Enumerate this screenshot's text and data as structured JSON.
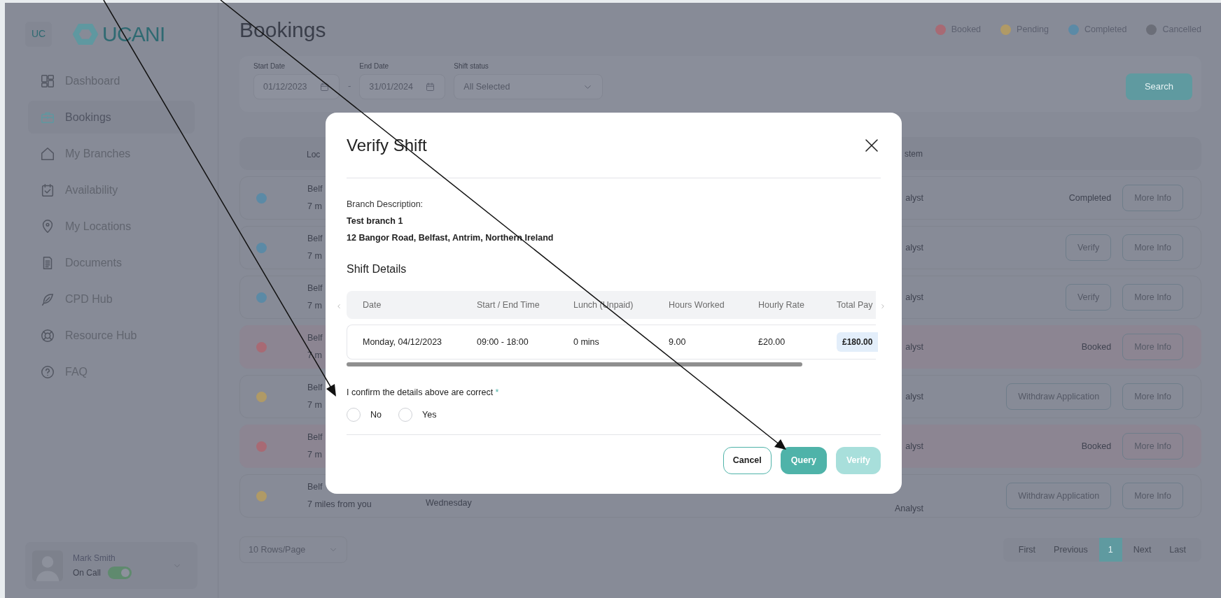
{
  "sidebar": {
    "badge": "UC",
    "logo": "UCANI",
    "items": [
      {
        "label": "Dashboard",
        "selected": false
      },
      {
        "label": "Bookings",
        "selected": true
      },
      {
        "label": "My Branches",
        "selected": false
      },
      {
        "label": "Availability",
        "selected": false
      },
      {
        "label": "My Locations",
        "selected": false
      },
      {
        "label": "Documents",
        "selected": false
      },
      {
        "label": "CPD Hub",
        "selected": false
      },
      {
        "label": "Resource Hub",
        "selected": false
      },
      {
        "label": "FAQ",
        "selected": false
      }
    ],
    "user": {
      "name": "Mark Smith",
      "status": "On Call",
      "on": true
    }
  },
  "header": {
    "title": "Bookings",
    "legend": [
      {
        "label": "Booked",
        "color": "#a86a74"
      },
      {
        "label": "Pending",
        "color": "#b09a66"
      },
      {
        "label": "Completed",
        "color": "#5b8aa6"
      },
      {
        "label": "Cancelled",
        "color": "#6b6e78"
      }
    ]
  },
  "filters": {
    "start_date": {
      "label": "Start Date",
      "value": "01/12/2023"
    },
    "separator": "-",
    "end_date": {
      "label": "End Date",
      "value": "31/01/2024"
    },
    "shift_status": {
      "label": "Shift status",
      "value": "All Selected"
    },
    "search": "Search"
  },
  "table": {
    "columns": [
      "Loc",
      "stem"
    ],
    "rows": [
      {
        "color": "#5b8aa6",
        "highlighted": false,
        "location": "Belf",
        "distance": "7 m",
        "role": "alyst",
        "status": "Completed",
        "actions": [
          "More Info"
        ]
      },
      {
        "color": "#5b8aa6",
        "highlighted": false,
        "location": "Belf",
        "distance": "7 m",
        "role": "alyst",
        "actions": [
          "Verify",
          "More Info"
        ]
      },
      {
        "color": "#5b8aa6",
        "highlighted": false,
        "location": "Belf",
        "distance": "7 m",
        "role": "alyst",
        "actions": [
          "Verify",
          "More Info"
        ]
      },
      {
        "color": "#a86a74",
        "highlighted": true,
        "location": "Belf",
        "distance": "7 m",
        "role": "alyst",
        "status": "Booked",
        "actions": [
          "More Info"
        ]
      },
      {
        "color": "#b09a66",
        "highlighted": false,
        "location": "Belf",
        "distance": "7 m",
        "role": "alyst",
        "actions": [
          "Withdraw Application",
          "More Info"
        ]
      },
      {
        "color": "#a86a74",
        "highlighted": true,
        "location": "Belf",
        "distance": "7 m",
        "role": "alyst",
        "status": "Booked",
        "actions": [
          "More Info"
        ]
      },
      {
        "color": "#b09a66",
        "highlighted": false,
        "location": "Belf",
        "distance": "7 miles from you",
        "day": "Wednesday",
        "role": "Analyst",
        "actions": [
          "Withdraw Application",
          "More Info"
        ]
      }
    ]
  },
  "pagination": {
    "rows_per_page": "10 Rows/Page",
    "pages": [
      {
        "label": "First",
        "selected": false
      },
      {
        "label": "Previous",
        "selected": false
      },
      {
        "label": "1",
        "selected": true
      },
      {
        "label": "Next",
        "selected": false
      },
      {
        "label": "Last",
        "selected": false
      }
    ]
  },
  "modal": {
    "title": "Verify Shift",
    "branch_label": "Branch Description:",
    "branch_name": "Test branch 1",
    "branch_address": "12 Bangor Road, Belfast, Antrim, Northern Ireland",
    "section": "Shift Details",
    "shift_table": {
      "columns": [
        "Date",
        "Start / End Time",
        "Lunch (Unpaid)",
        "Hours Worked",
        "Hourly Rate",
        "Total Pay"
      ],
      "rows": [
        [
          "Monday, 04/12/2023",
          "09:00 - 18:00",
          "0 mins",
          "9.00",
          "£20.00",
          "£180.00"
        ]
      ]
    },
    "confirm": {
      "label": "I confirm the details above are correct",
      "required": "*",
      "options": [
        {
          "label": "No",
          "selected": false
        },
        {
          "label": "Yes",
          "selected": false
        }
      ]
    },
    "buttons": [
      {
        "label": "Cancel",
        "kind": "outline",
        "disabled": false
      },
      {
        "label": "Query",
        "kind": "primary",
        "disabled": false
      },
      {
        "label": "Verify",
        "kind": "primary",
        "disabled": true
      }
    ]
  }
}
